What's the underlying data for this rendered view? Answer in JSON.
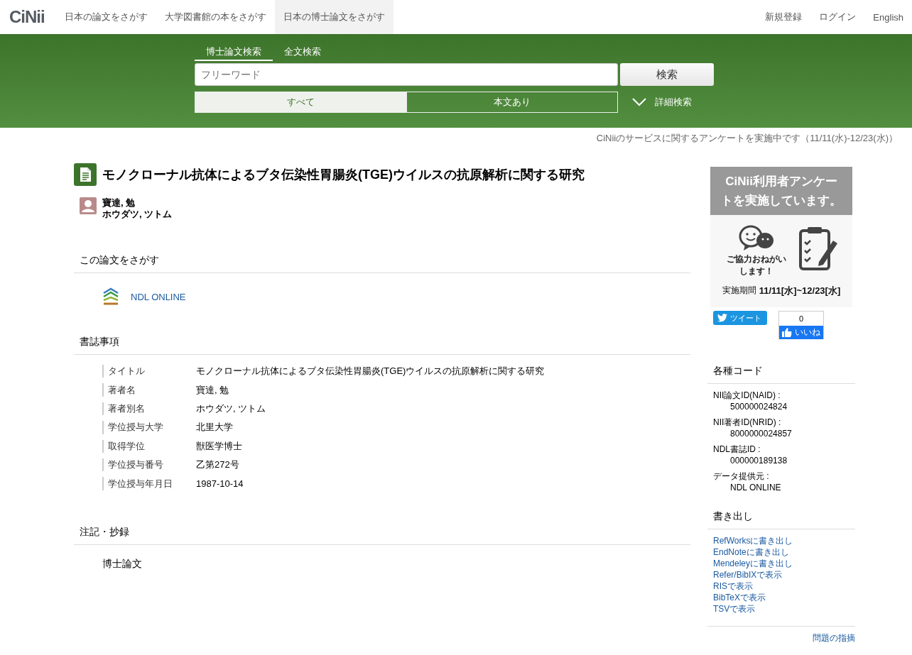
{
  "header": {
    "logo": "CiNii",
    "nav": [
      {
        "label": "日本の論文をさがす",
        "selected": false
      },
      {
        "label": "大学図書館の本をさがす",
        "selected": false
      },
      {
        "label": "日本の博士論文をさがす",
        "selected": true
      }
    ],
    "account_links": [
      "新規登録",
      "ログイン",
      "English"
    ]
  },
  "search": {
    "tabs": [
      {
        "label": "博士論文検索",
        "selected": true
      },
      {
        "label": "全文検索",
        "selected": false
      }
    ],
    "placeholder": "フリーワード",
    "button": "検索",
    "filters": [
      {
        "label": "すべて",
        "selected": true
      },
      {
        "label": "本文あり",
        "selected": false
      }
    ],
    "advanced": "詳細検索"
  },
  "notice": "CiNiiのサービスに関するアンケートを実施中です（11/11(水)-12/23(水)）",
  "article": {
    "title": "モノクローナル抗体によるブタ伝染性胃腸炎(TGE)ウイルスの抗原解析に関する研究",
    "author": {
      "name": "寶達, 勉",
      "reading": "ホウダツ, ツトム"
    },
    "sections": [
      {
        "kind": "links",
        "heading": "この論文をさがす",
        "links": [
          "NDL ONLINE"
        ]
      },
      {
        "kind": "fields",
        "heading": "書誌事項",
        "fields": [
          {
            "label": "タイトル",
            "value": "モノクローナル抗体によるブタ伝染性胃腸炎(TGE)ウイルスの抗原解析に関する研究"
          },
          {
            "label": "著者名",
            "value": "寶達, 勉"
          },
          {
            "label": "著者別名",
            "value": "ホウダツ, ツトム"
          },
          {
            "label": "学位授与大学",
            "value": "北里大学"
          },
          {
            "label": "取得学位",
            "value": "獣医学博士"
          },
          {
            "label": "学位授与番号",
            "value": "乙第272号"
          },
          {
            "label": "学位授与年月日",
            "value": "1987-10-14"
          }
        ]
      },
      {
        "kind": "text",
        "heading": "注記・抄録",
        "text": "博士論文"
      }
    ]
  },
  "sidebar": {
    "banner": {
      "heading": "CiNii利用者アンケートを実施しています。",
      "caption": "ご協力おねがいします！",
      "period_label": "実施期間",
      "period": "11/11[水]~12/23[水]"
    },
    "social": {
      "tweet": "ツイート",
      "like_count": "0",
      "like": "いいね"
    },
    "codes": {
      "heading": "各種コード",
      "items": [
        {
          "label": "NII論文ID(NAID) :",
          "value": "500000024824"
        },
        {
          "label": "NII著者ID(NRID) :",
          "value": "8000000024857"
        },
        {
          "label": "NDL書誌ID :",
          "value": "000000189138"
        },
        {
          "label": "データ提供元 :",
          "value": "NDL ONLINE"
        }
      ]
    },
    "export": {
      "heading": "書き出し",
      "links": [
        "RefWorksに書き出し",
        "EndNoteに書き出し",
        "Mendeleyに書き出し",
        "Refer/BibIXで表示",
        "RISで表示",
        "BibTeXで表示",
        "TSVで表示"
      ]
    },
    "report": "問題の指摘"
  }
}
